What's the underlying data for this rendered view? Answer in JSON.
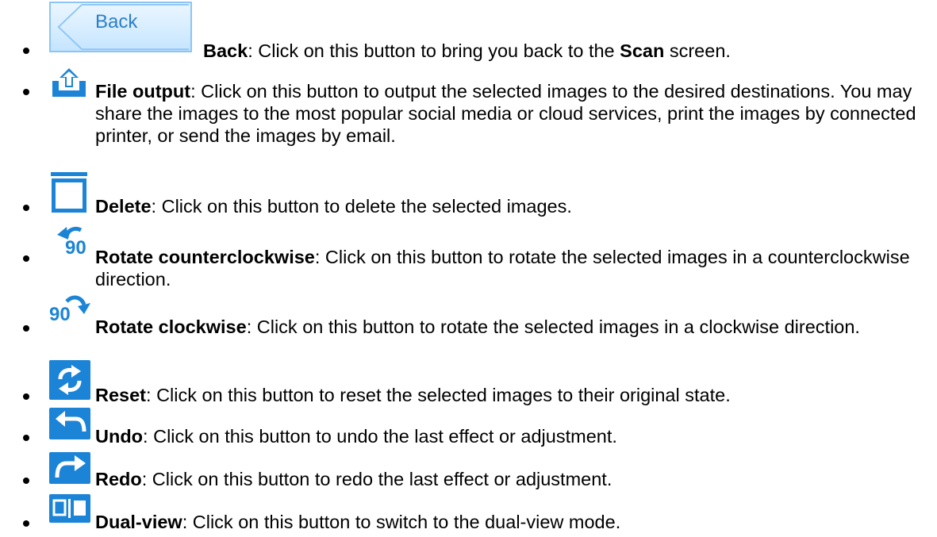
{
  "colors": {
    "icon_blue": "#1b84d6",
    "back_border": "#8cc5f5",
    "back_text": "#2b7fc8"
  },
  "back_button": {
    "label": "Back",
    "icon": "chevron-left-icon"
  },
  "items": [
    {
      "title": "Back",
      "pre": ": Click on this button to bring you back to the ",
      "emph": "Scan",
      "post": " screen.",
      "icon": "back-button-icon"
    },
    {
      "title": "File output",
      "text": ": Click on this button to output the selected images to the desired destinations. You may share the images to the most popular social media or cloud services, print the images by connected printer, or send the images by email.",
      "icon": "upload-icon"
    },
    {
      "title": "Delete",
      "text": ": Click on this button to delete the selected images.",
      "icon": "trash-icon"
    },
    {
      "title": "Rotate counterclockwise",
      "text": ": Click on this button to rotate the selected images in a counterclockwise direction.",
      "icon": "rotate-ccw-90-icon",
      "icon_text": "90"
    },
    {
      "title": "Rotate clockwise",
      "text": ": Click on this button to rotate the selected images in a clockwise direction.",
      "icon": "rotate-cw-90-icon",
      "icon_text": "90"
    },
    {
      "title": "Reset",
      "text": ": Click on this button to reset the selected images to their original state.",
      "icon": "reset-icon"
    },
    {
      "title": "Undo",
      "text": ": Click on this button to undo the last effect or adjustment.",
      "icon": "undo-icon"
    },
    {
      "title": "Redo",
      "text": ": Click on this button to redo the last effect or adjustment.",
      "icon": "redo-icon"
    },
    {
      "title": "Dual-view",
      "text": ": Click on this button to switch to the dual-view mode.",
      "icon": "dual-view-icon"
    }
  ]
}
